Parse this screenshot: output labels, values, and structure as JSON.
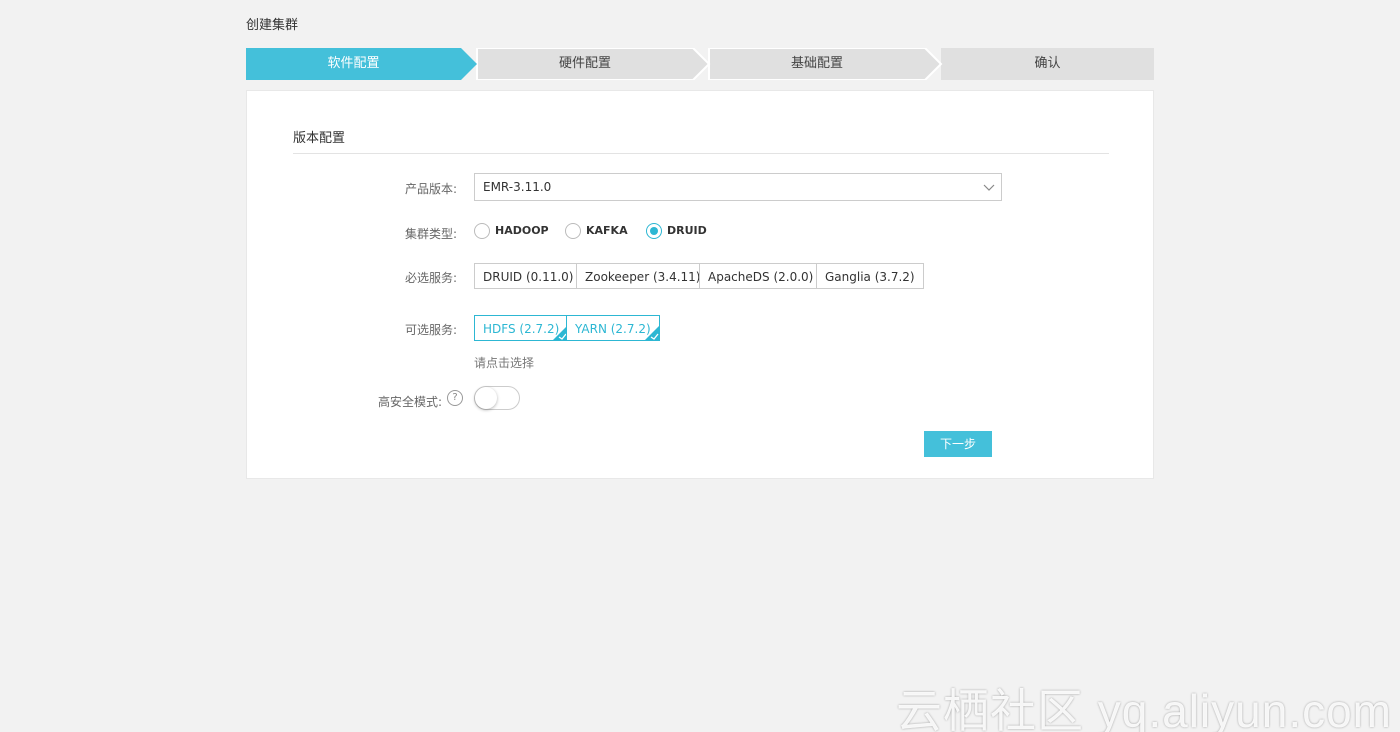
{
  "page": {
    "title": "创建集群"
  },
  "steps": [
    {
      "label": "软件配置",
      "active": true
    },
    {
      "label": "硬件配置",
      "active": false
    },
    {
      "label": "基础配置",
      "active": false
    },
    {
      "label": "确认",
      "active": false
    }
  ],
  "colors": {
    "accent": "#44c0da",
    "step_inactive": "#e0e0e0",
    "page_bg": "#f2f2f2"
  },
  "section": {
    "title": "版本配置"
  },
  "form": {
    "product_version": {
      "label": "产品版本:",
      "value": "EMR-3.11.0",
      "icon": "chevron-down-icon"
    },
    "cluster_type": {
      "label": "集群类型:",
      "options": [
        {
          "label": "HADOOP",
          "checked": false
        },
        {
          "label": "KAFKA",
          "checked": false
        },
        {
          "label": "DRUID",
          "checked": true
        }
      ]
    },
    "required_services": {
      "label": "必选服务:",
      "items": [
        "DRUID (0.11.0)",
        "Zookeeper (3.4.11)",
        "ApacheDS (2.0.0)",
        "Ganglia (3.7.2)"
      ]
    },
    "optional_services": {
      "label": "可选服务:",
      "items": [
        {
          "label": "HDFS (2.7.2)",
          "selected": true
        },
        {
          "label": "YARN (2.7.2)",
          "selected": true
        }
      ],
      "hint": "请点击选择"
    },
    "high_security": {
      "label": "高安全模式:",
      "help": "?",
      "enabled": false
    }
  },
  "actions": {
    "next_label": "下一步"
  },
  "watermark": "云栖社区 yq.aliyun.com"
}
